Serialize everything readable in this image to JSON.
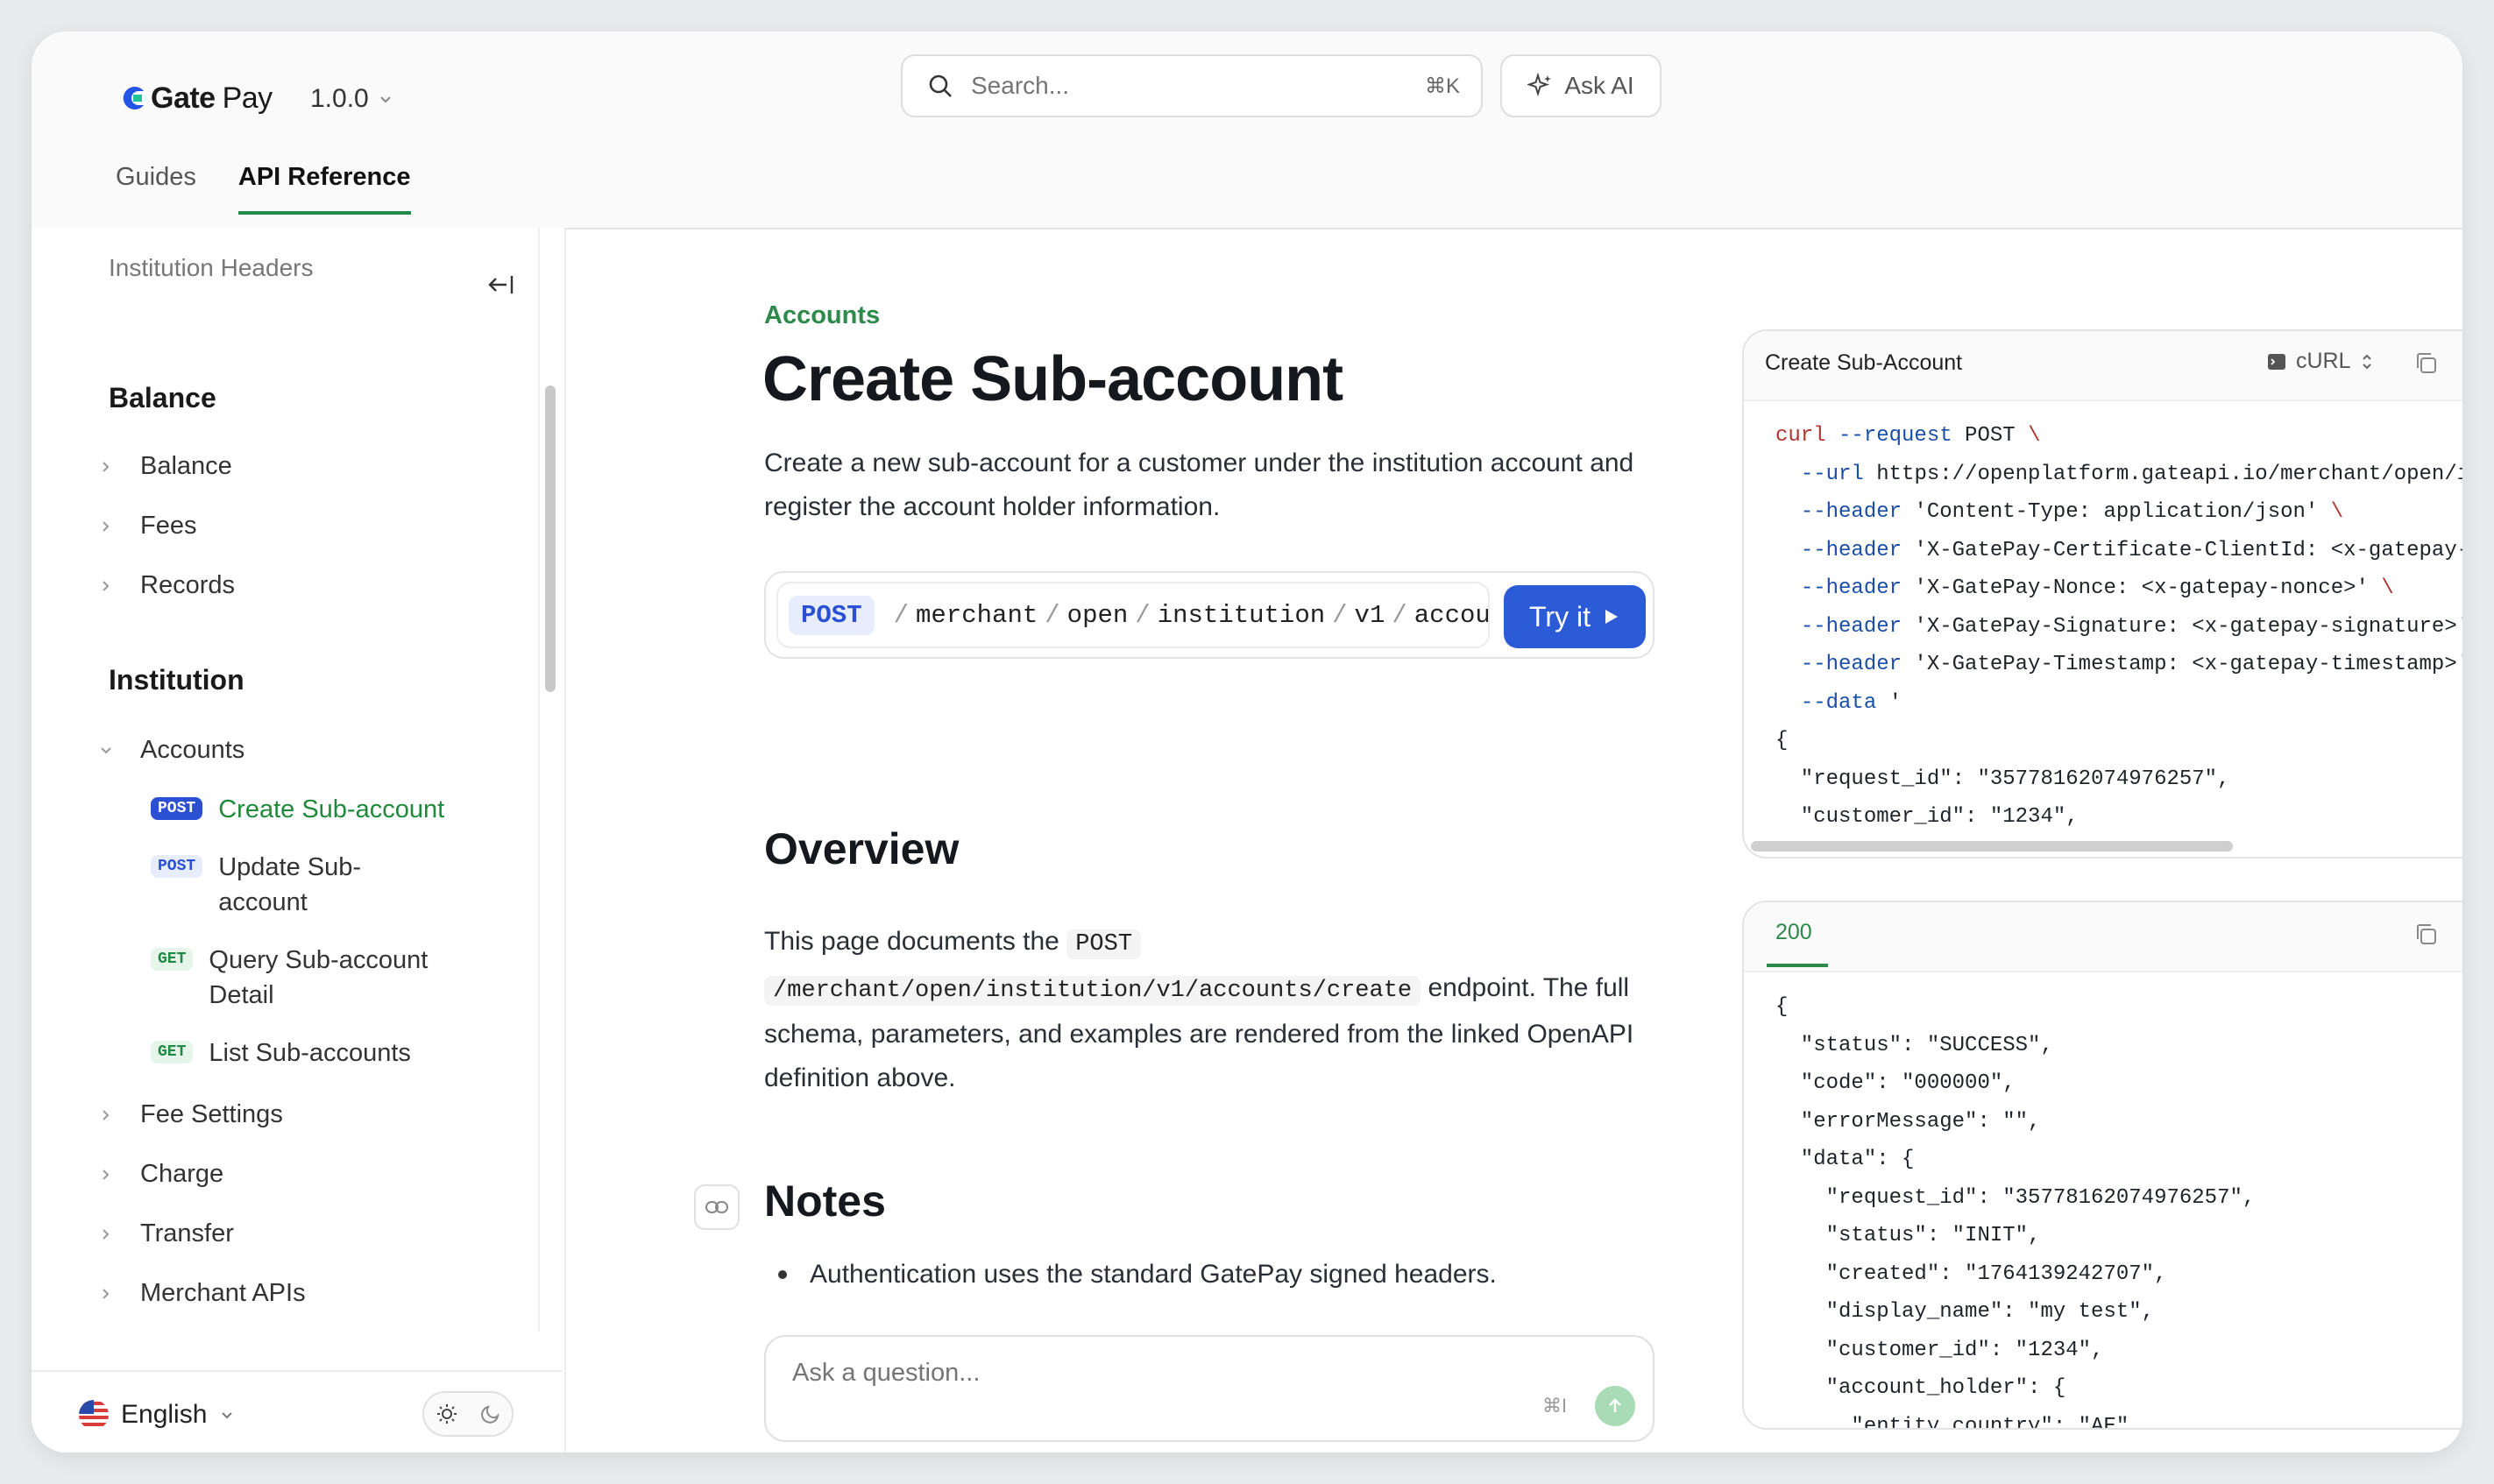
{
  "header": {
    "logo_main": "Gate",
    "logo_sub": "Pay",
    "version": "1.0.0",
    "search_placeholder": "Search...",
    "search_shortcut": "⌘K",
    "ask_ai": "Ask AI",
    "tabs": [
      {
        "label": "Guides"
      },
      {
        "label": "API Reference"
      }
    ]
  },
  "sidebar": {
    "header_item": "Institution Headers",
    "group_balance": "Balance",
    "balance_items": [
      "Balance",
      "Fees",
      "Records"
    ],
    "group_institution": "Institution",
    "accounts": "Accounts",
    "account_items": [
      {
        "method": "POST",
        "label": "Create Sub-account"
      },
      {
        "method": "POST",
        "label": "Update Sub-account"
      },
      {
        "method": "GET",
        "label": "Query Sub-account Detail"
      },
      {
        "method": "GET",
        "label": "List Sub-accounts"
      }
    ],
    "institution_items": [
      "Fee Settings",
      "Charge",
      "Transfer",
      "Merchant APIs"
    ],
    "language": "English"
  },
  "main": {
    "breadcrumb": "Accounts",
    "title": "Create Sub-account",
    "description": "Create a new sub-account for a customer under the institution account and register the account holder information.",
    "endpoint": {
      "method": "POST",
      "segments": [
        "merchant",
        "open",
        "institution",
        "v1",
        "accounts"
      ],
      "try_it": "Try it"
    },
    "overview_heading": "Overview",
    "overview_pre": "This page documents the",
    "overview_code1": "POST",
    "overview_code2": "/merchant/open/institution/v1/accounts/create",
    "overview_post": "endpoint. The full schema, parameters, and examples are rendered from the linked OpenAPI definition above.",
    "notes_heading": "Notes",
    "notes_bullet": "Authentication uses the standard GatePay signed headers.",
    "ask_placeholder": "Ask a question...",
    "ask_shortcut": "⌘I"
  },
  "request_panel": {
    "title": "Create Sub-Account",
    "language": "cURL",
    "lines": [
      "curl --request POST \\",
      "  --url https://openplatform.gateapi.io/merchant/open/ins",
      "  --header 'Content-Type: application/json' \\",
      "  --header 'X-GatePay-Certificate-ClientId: <x-gatepay-ce",
      "  --header 'X-GatePay-Nonce: <x-gatepay-nonce>' \\",
      "  --header 'X-GatePay-Signature: <x-gatepay-signature>' \\",
      "  --header 'X-GatePay-Timestamp: <x-gatepay-timestamp>' \\",
      "  --data '",
      "{",
      "  \"request_id\": \"35778162074976257\",",
      "  \"customer_id\": \"1234\","
    ]
  },
  "response_panel": {
    "status": "200",
    "lines": [
      "{",
      "  \"status\": \"SUCCESS\",",
      "  \"code\": \"000000\",",
      "  \"errorMessage\": \"\",",
      "  \"data\": {",
      "    \"request_id\": \"35778162074976257\",",
      "    \"status\": \"INIT\",",
      "    \"created\": \"1764139242707\",",
      "    \"display_name\": \"my test\",",
      "    \"customer_id\": \"1234\",",
      "    \"account_holder\": {",
      "      \"entity_country\": \"AE\","
    ]
  },
  "colors": {
    "accent_green": "#2d8a4a",
    "post_blue": "#2b50d4",
    "try_it": "#2b5bd7"
  }
}
